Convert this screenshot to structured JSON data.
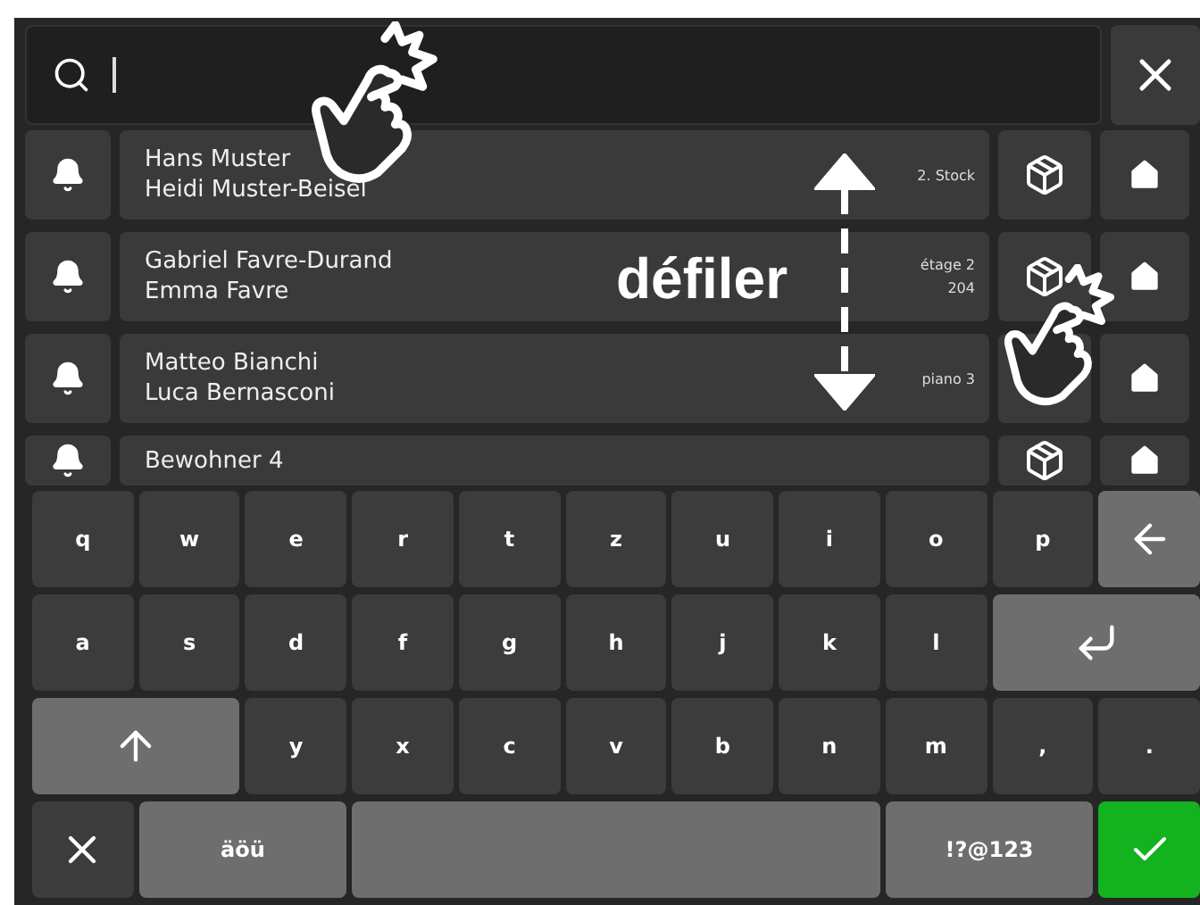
{
  "residents": [
    {
      "names": [
        "Hans Muster",
        "Heidi Muster-Beisel"
      ],
      "location": [
        "2. Stock"
      ]
    },
    {
      "names": [
        "Gabriel Favre-Durand",
        "Emma Favre"
      ],
      "location": [
        "étage 2",
        "204"
      ]
    },
    {
      "names": [
        "Matteo Bianchi",
        "Luca Bernasconi"
      ],
      "location": [
        "piano 3"
      ]
    },
    {
      "names": [
        "Bewohner 4"
      ]
    }
  ],
  "keyboard": [
    [
      {
        "kind": "char",
        "label": "q"
      },
      {
        "kind": "char",
        "label": "w"
      },
      {
        "kind": "char",
        "label": "e"
      },
      {
        "kind": "char",
        "label": "r"
      },
      {
        "kind": "char",
        "label": "t"
      },
      {
        "kind": "char",
        "label": "z"
      },
      {
        "kind": "char",
        "label": "u"
      },
      {
        "kind": "char",
        "label": "i"
      },
      {
        "kind": "char",
        "label": "o"
      },
      {
        "kind": "char",
        "label": "p"
      },
      {
        "kind": "backspace"
      }
    ],
    [
      {
        "kind": "char",
        "label": "a"
      },
      {
        "kind": "char",
        "label": "s"
      },
      {
        "kind": "char",
        "label": "d"
      },
      {
        "kind": "char",
        "label": "f"
      },
      {
        "kind": "char",
        "label": "g"
      },
      {
        "kind": "char",
        "label": "h"
      },
      {
        "kind": "char",
        "label": "j"
      },
      {
        "kind": "char",
        "label": "k"
      },
      {
        "kind": "char",
        "label": "l"
      },
      {
        "kind": "enter"
      }
    ],
    [
      {
        "kind": "shift"
      },
      {
        "kind": "char",
        "label": "y"
      },
      {
        "kind": "char",
        "label": "x"
      },
      {
        "kind": "char",
        "label": "c"
      },
      {
        "kind": "char",
        "label": "v"
      },
      {
        "kind": "char",
        "label": "b"
      },
      {
        "kind": "char",
        "label": "n"
      },
      {
        "kind": "char",
        "label": "m"
      },
      {
        "kind": "char",
        "label": ","
      },
      {
        "kind": "char",
        "label": "."
      }
    ],
    [
      {
        "kind": "close"
      },
      {
        "kind": "alt",
        "label": "äöü"
      },
      {
        "kind": "space"
      },
      {
        "kind": "alt",
        "label": "!?@123"
      },
      {
        "kind": "confirm"
      }
    ]
  ],
  "annotation": {
    "label": "défiler"
  }
}
